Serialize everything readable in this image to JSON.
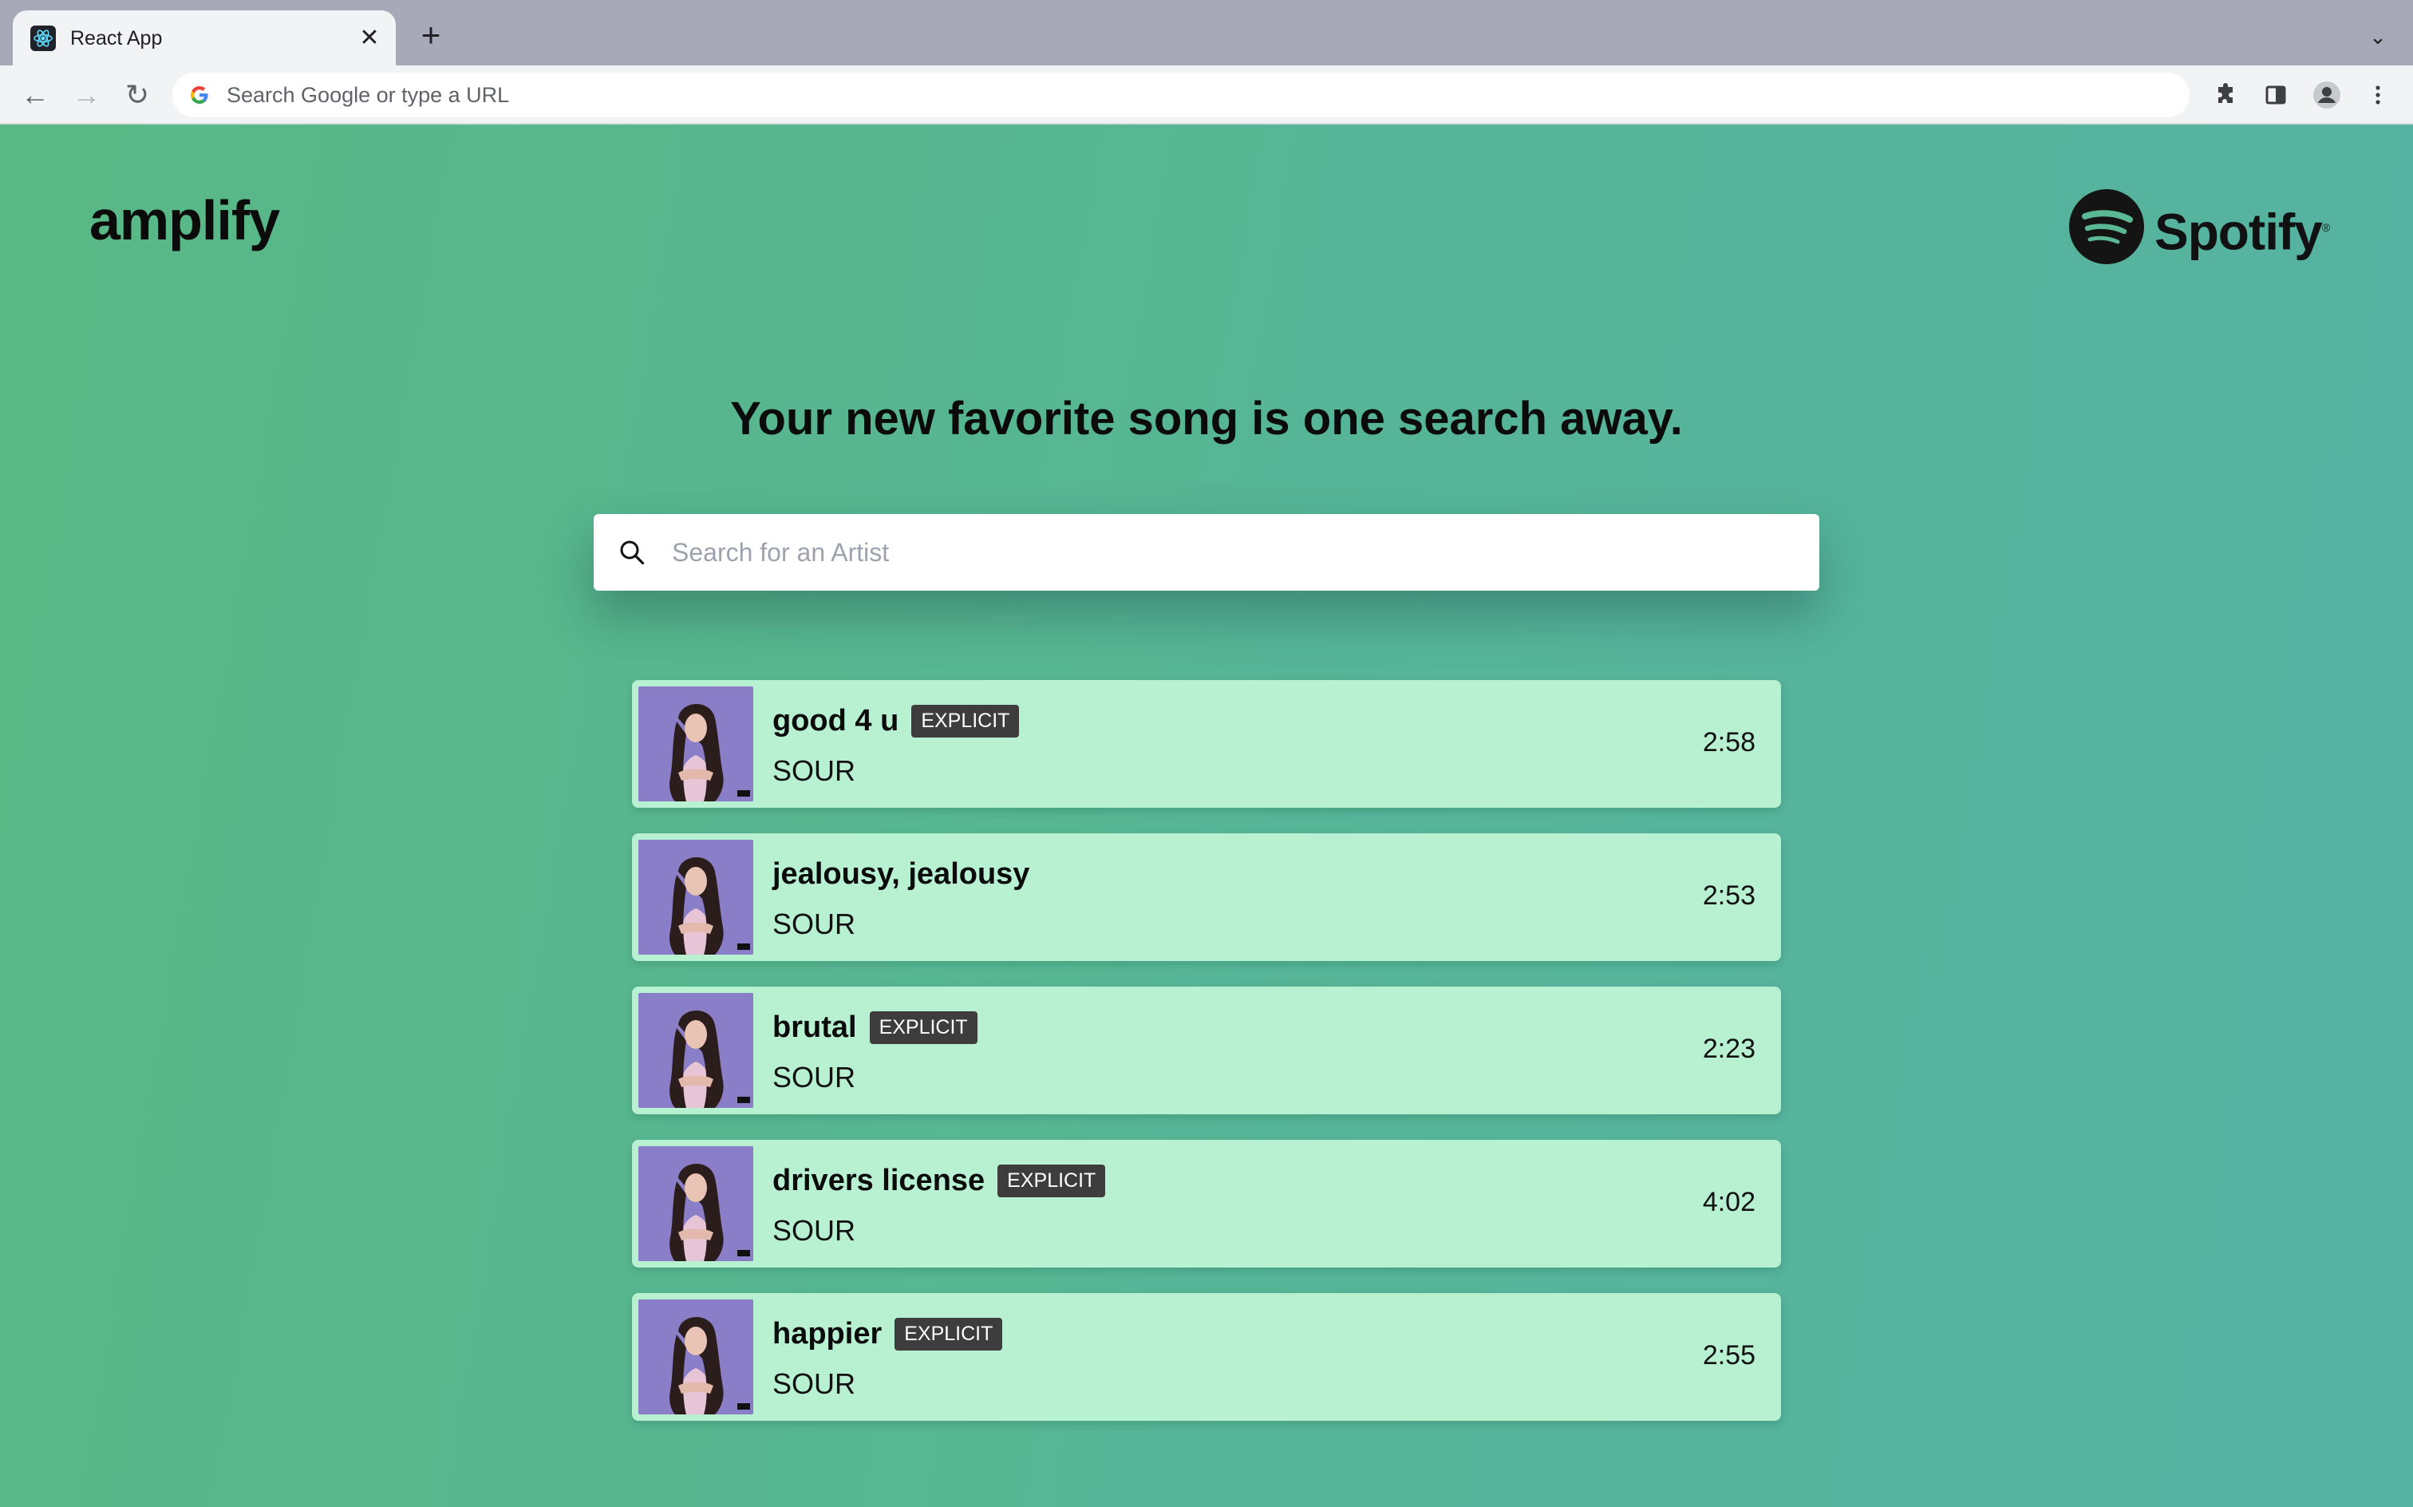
{
  "browser": {
    "tab_title": "React App",
    "tab_close": "✕",
    "new_tab": "+",
    "tab_menu": "⌄",
    "omnibox_placeholder": "Search Google or type a URL",
    "nav": {
      "back": "←",
      "forward": "→",
      "reload": "↻"
    },
    "icons": [
      "react-icon",
      "google-icon",
      "extensions-icon",
      "side-panel-icon",
      "profile-icon",
      "menu-icon"
    ]
  },
  "header": {
    "brand": "amplify",
    "spotify_logo": "Spotify"
  },
  "hero": {
    "headline": "Your new favorite song is one search away."
  },
  "search": {
    "placeholder": "Search for an Artist"
  },
  "tracks": [
    {
      "title": "good 4 u",
      "explicit": true,
      "badge": "EXPLICIT",
      "album": "SOUR",
      "duration": "2:58"
    },
    {
      "title": "jealousy, jealousy",
      "explicit": false,
      "badge": "",
      "album": "SOUR",
      "duration": "2:53"
    },
    {
      "title": "brutal",
      "explicit": true,
      "badge": "EXPLICIT",
      "album": "SOUR",
      "duration": "2:23"
    },
    {
      "title": "drivers license",
      "explicit": true,
      "badge": "EXPLICIT",
      "album": "SOUR",
      "duration": "4:02"
    },
    {
      "title": "happier",
      "explicit": true,
      "badge": "EXPLICIT",
      "album": "SOUR",
      "duration": "2:55"
    }
  ],
  "colors": {
    "page_gradient_start": "#59b885",
    "page_gradient_end": "#55b2a3",
    "track_card": "#b8f0d2",
    "explicit_badge": "#3d3d3d",
    "album_cover": "#8d80c9"
  }
}
